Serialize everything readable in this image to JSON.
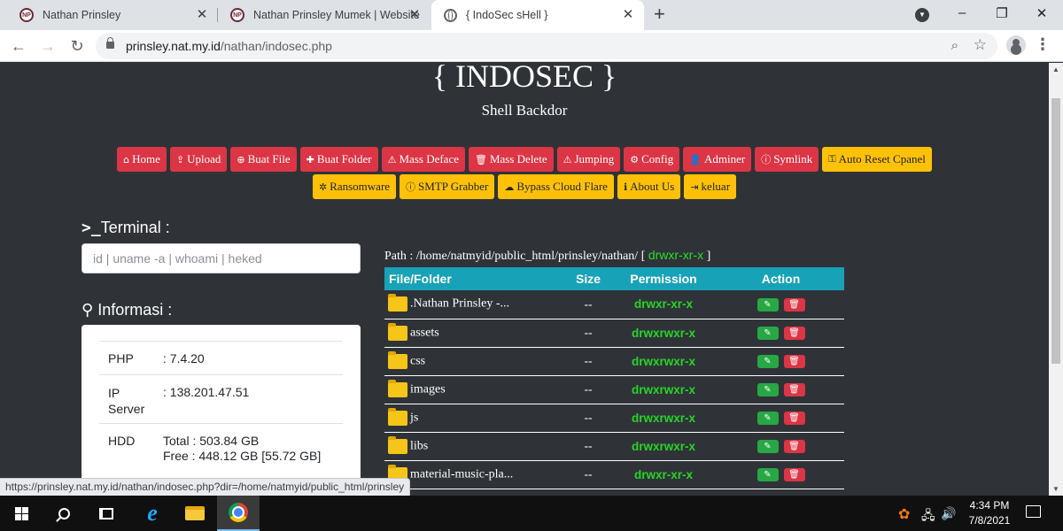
{
  "tabs": [
    {
      "title": "Nathan Prinsley",
      "close": "✕"
    },
    {
      "title": "Nathan Prinsley Mumek | Website",
      "close": "✕"
    },
    {
      "title": "{ IndoSec sHell }",
      "close": "✕"
    }
  ],
  "tabstrip": {
    "new_tab": "+",
    "minimize": "–",
    "maximize": "❐",
    "close": "✕"
  },
  "address": {
    "host": "prinsley.nat.my.id",
    "path": "/nathan/indosec.php"
  },
  "header": {
    "title": "{ INDOSEC }",
    "subtitle": "Shell Backdor"
  },
  "menu_row1": [
    {
      "icon": "home-icon",
      "glyph": "⌂",
      "label": "Home",
      "color": "red"
    },
    {
      "icon": "upload-icon",
      "glyph": "⇪",
      "label": "Upload",
      "color": "red"
    },
    {
      "icon": "plus-circle-icon",
      "glyph": "⊕",
      "label": "Buat File",
      "color": "red"
    },
    {
      "icon": "plus-icon",
      "glyph": "✚",
      "label": "Buat Folder",
      "color": "red"
    },
    {
      "icon": "warning-icon",
      "glyph": "⚠",
      "label": "Mass Deface",
      "color": "red"
    },
    {
      "icon": "trash-icon",
      "glyph": "🗑",
      "label": "Mass Delete",
      "color": "red"
    },
    {
      "icon": "warning-icon",
      "glyph": "⚠",
      "label": "Jumping",
      "color": "red"
    },
    {
      "icon": "cogs-icon",
      "glyph": "⚙",
      "label": "Config",
      "color": "red"
    },
    {
      "icon": "user-icon",
      "glyph": "👤",
      "label": "Adminer",
      "color": "red"
    },
    {
      "icon": "info-circle-icon",
      "glyph": "ⓘ",
      "label": "Symlink",
      "color": "red"
    },
    {
      "icon": "key-icon",
      "glyph": "⚿",
      "label": "Auto Reset Cpanel",
      "color": "yellow"
    }
  ],
  "menu_row2": [
    {
      "icon": "bug-icon",
      "glyph": "✲",
      "label": "Ransomware",
      "color": "yellow"
    },
    {
      "icon": "info-circle-icon",
      "glyph": "ⓘ",
      "label": "SMTP Grabber",
      "color": "yellow"
    },
    {
      "icon": "cloud-icon",
      "glyph": "☁",
      "label": "Bypass Cloud Flare",
      "color": "yellow"
    },
    {
      "icon": "info-icon",
      "glyph": "ℹ",
      "label": "About Us",
      "color": "yellow"
    },
    {
      "icon": "sign-out-icon",
      "glyph": "⇥",
      "label": "keluar",
      "color": "yellow"
    }
  ],
  "terminal": {
    "tag": ">_",
    "title": "Terminal :",
    "placeholder": "id | uname -a | whoami | heked"
  },
  "info": {
    "title": "Informasi :",
    "rows": [
      {
        "key": "PHP",
        "value": ": 7.4.20"
      },
      {
        "key": "IP Server",
        "value": ": 138.201.47.51"
      },
      {
        "key": "HDD",
        "value": "Total : 503.84 GB",
        "value2": "Free : 448.12 GB [55.72 GB]"
      }
    ]
  },
  "path": {
    "label": "Path : /home/natmyid/public_html/prinsley/nathan/",
    "open": "[",
    "perm": "drwxr-xr-x",
    "close": "]"
  },
  "table": {
    "headers": [
      "File/Folder",
      "Size",
      "Permission",
      "Action"
    ],
    "rows": [
      {
        "name": ".Nathan Prinsley -...",
        "size": "--",
        "perm": "drwxr-xr-x"
      },
      {
        "name": "assets",
        "size": "--",
        "perm": "drwxrwxr-x"
      },
      {
        "name": "css",
        "size": "--",
        "perm": "drwxrwxr-x"
      },
      {
        "name": "images",
        "size": "--",
        "perm": "drwxrwxr-x"
      },
      {
        "name": "js",
        "size": "--",
        "perm": "drwxrwxr-x"
      },
      {
        "name": "libs",
        "size": "--",
        "perm": "drwxrwxr-x"
      },
      {
        "name": "material-music-pla...",
        "size": "--",
        "perm": "drwxr-xr-x"
      }
    ],
    "edit_glyph": "✎",
    "delete_glyph": "🗑"
  },
  "status_url": "https://prinsley.nat.my.id/nathan/indosec.php?dir=/home/natmyid/public_html/prinsley",
  "taskbar": {
    "time": "4:34 PM",
    "date": "7/8/2021"
  },
  "colors": {
    "bg": "#2f3338",
    "red": "#dc3545",
    "yellow": "#ffc107",
    "teal": "#17a2b8",
    "perm_green": "#28d428"
  }
}
